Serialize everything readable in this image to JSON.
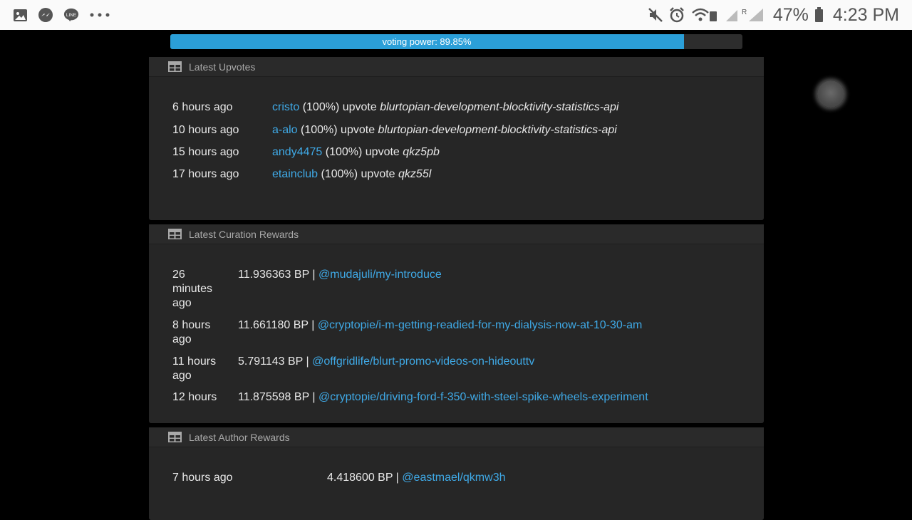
{
  "statusbar": {
    "battery": "47%",
    "time": "4:23 PM",
    "signal_label": "R"
  },
  "voting_power": {
    "label": "voting power: 89.85%",
    "value": 89.85
  },
  "upvotes": {
    "title": "Latest Upvotes",
    "rows": [
      {
        "time": "6 hours ago",
        "user": "cristo",
        "pct": "(100%) upvote",
        "post": "blurtopian-development-blocktivity-statistics-api"
      },
      {
        "time": "10 hours ago",
        "user": "a-alo",
        "pct": "(100%) upvote",
        "post": "blurtopian-development-blocktivity-statistics-api"
      },
      {
        "time": "15 hours ago",
        "user": "andy4475",
        "pct": "(100%) upvote",
        "post": "qkz5pb"
      },
      {
        "time": "17 hours ago",
        "user": "etainclub",
        "pct": "(100%) upvote",
        "post": "qkz55l"
      }
    ]
  },
  "curation": {
    "title": "Latest Curation Rewards",
    "rows": [
      {
        "time_lines": [
          "26",
          "minutes",
          "ago"
        ],
        "amount": "11.936363 BP |",
        "link": "@mudajuli/my-introduce"
      },
      {
        "time_lines": [
          "8 hours",
          "ago"
        ],
        "amount": "11.661180 BP |",
        "link": "@cryptopie/i-m-getting-readied-for-my-dialysis-now-at-10-30-am"
      },
      {
        "time_lines": [
          "11 hours",
          "ago"
        ],
        "amount": "5.791143 BP |",
        "link": "@offgridlife/blurt-promo-videos-on-hideouttv"
      },
      {
        "time_lines": [
          "12 hours"
        ],
        "amount": "11.875598 BP |",
        "link": "@cryptopie/driving-ford-f-350-with-steel-spike-wheels-experiment"
      }
    ]
  },
  "author": {
    "title": "Latest Author Rewards",
    "rows": [
      {
        "time": "7 hours ago",
        "amount": "4.418600 BP |",
        "link": "@eastmael/qkmw3h"
      }
    ]
  },
  "icons": {
    "gallery": "gallery-icon",
    "messenger": "messenger-icon",
    "line": "line-app-icon",
    "more": "more-icon",
    "mute": "mute-icon",
    "alarm": "alarm-icon",
    "wifi": "wifi-icon",
    "signal": "signal-icon",
    "battery": "battery-icon",
    "table": "table-icon",
    "float": "floating-assist-button"
  },
  "colors": {
    "accent": "#2b9fd8",
    "link": "#3fa9e6",
    "panel": "#262626"
  }
}
